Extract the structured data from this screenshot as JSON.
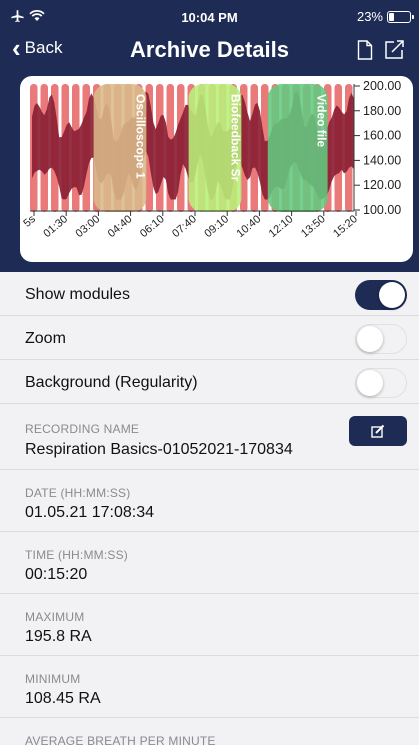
{
  "status": {
    "time": "10:04 PM",
    "battery_text": "23%",
    "battery_level": 0.23
  },
  "nav": {
    "back_label": "Back",
    "title": "Archive Details"
  },
  "chart_data": {
    "type": "area",
    "x_tick_labels": [
      "5s",
      "01:30",
      "03:00",
      "04:40",
      "06:10",
      "07:40",
      "09:10",
      "10:40",
      "12:10",
      "13:50",
      "15:20"
    ],
    "y_tick_labels": [
      "200.00",
      "180.00",
      "160.00",
      "140.00",
      "120.00",
      "100.00"
    ],
    "ylim": [
      100,
      200
    ],
    "xlim_seconds": [
      5,
      920
    ],
    "modules": [
      {
        "name": "Oscilloscope 1",
        "color": "#d9b98a",
        "start_s": 180,
        "end_s": 330
      },
      {
        "name": "Biofeedback Sr",
        "color": "#b8f07a",
        "start_s": 450,
        "end_s": 600
      },
      {
        "name": "Video file",
        "color": "#63c97f",
        "start_s": 675,
        "end_s": 845
      }
    ],
    "signal_color": "#8c1f35",
    "stripe_color": "#e86a6a"
  },
  "settings": {
    "show_modules": {
      "label": "Show modules",
      "on": true
    },
    "zoom": {
      "label": "Zoom",
      "on": false
    },
    "background": {
      "label": "Background (Regularity)",
      "on": false
    }
  },
  "details": {
    "recording_name": {
      "caption": "RECORDING NAME",
      "value": "Respiration Basics-01052021-170834"
    },
    "date": {
      "caption": "DATE (HH:MM:SS)",
      "value": "01.05.21 17:08:34"
    },
    "time": {
      "caption": "TIME (HH:MM:SS)",
      "value": "00:15:20"
    },
    "maximum": {
      "caption": "MAXIMUM",
      "value": "195.8 RA"
    },
    "minimum": {
      "caption": "MINIMUM",
      "value": "108.45 RA"
    },
    "avg_breath": {
      "caption": "AVERAGE BREATH PER MINUTE"
    }
  }
}
